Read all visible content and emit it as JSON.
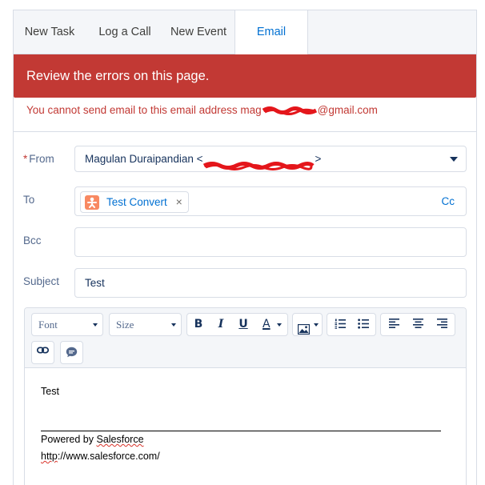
{
  "tabs": [
    {
      "label": "New Task"
    },
    {
      "label": "Log a Call"
    },
    {
      "label": "New Event"
    },
    {
      "label": "Email"
    }
  ],
  "active_tab": "Email",
  "error": {
    "banner": "Review the errors on this page.",
    "detail_prefix": "You cannot send email to this email address mag",
    "detail_suffix": "@gmail.com"
  },
  "form": {
    "from": {
      "label": "From",
      "required_marker": "*",
      "value": "Magulan Duraipandian <",
      "value_suffix": ">"
    },
    "to": {
      "label": "To",
      "recipient": "Test Convert",
      "remove_glyph": "×",
      "cc_label": "Cc"
    },
    "bcc": {
      "label": "Bcc",
      "value": ""
    },
    "subject": {
      "label": "Subject",
      "value": "Test"
    }
  },
  "toolbar": {
    "font_label": "Font",
    "size_label": "Size",
    "bold": "B",
    "italic": "I",
    "underline": "U",
    "text_color": "A"
  },
  "body": {
    "line1": "Test",
    "powered_prefix": "Powered by ",
    "powered_link": "Salesforce",
    "url_prefix": "http",
    "url_rest": "://www.salesforce.com/"
  },
  "colors": {
    "error": "#c23934",
    "link": "#0070d2",
    "contact_icon": "#f88962"
  }
}
